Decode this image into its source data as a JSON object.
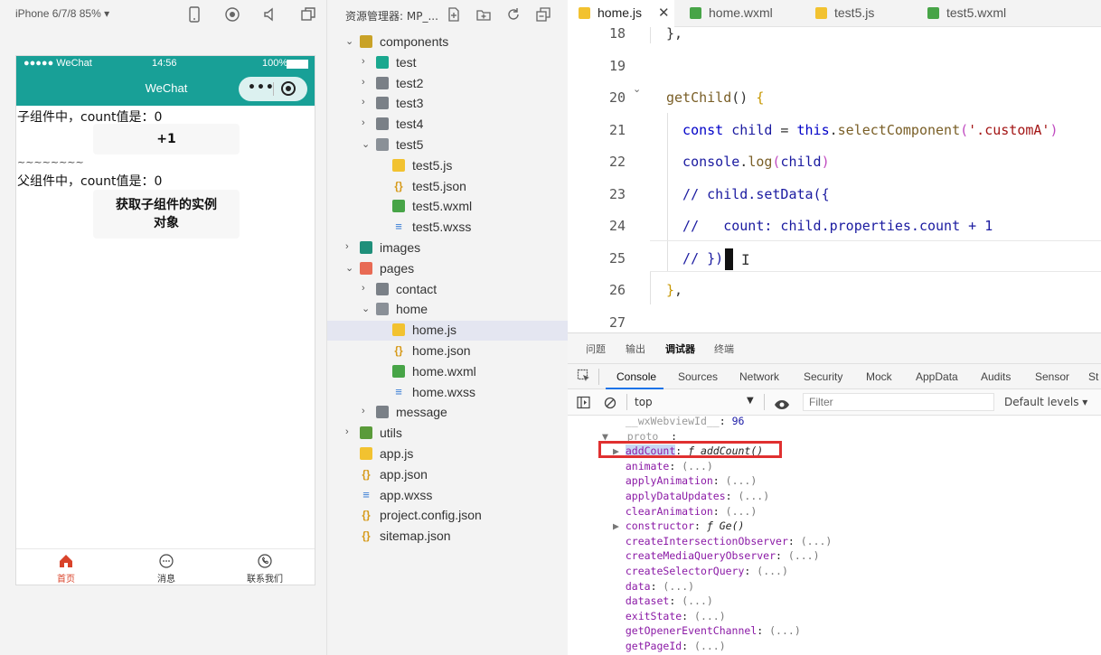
{
  "simulator": {
    "device_label": "iPhone 6/7/8 85% ▾",
    "status_bar": {
      "carrier": "●●●●● WeChat",
      "time": "14:56",
      "battery": "100%"
    },
    "nav_title": "WeChat",
    "capsule_dots": "•••",
    "child_text": "子组件中，count值是：0",
    "plus_button": "+1",
    "divider_text": "~~~~~~~~",
    "parent_text": "父组件中，count值是：0",
    "get_child_button_line1": "获取子组件的实例",
    "get_child_button_line2": "对象",
    "tabbar": [
      {
        "label": "首页",
        "icon": "home-icon",
        "active": true
      },
      {
        "label": "消息",
        "icon": "message-icon",
        "active": false
      },
      {
        "label": "联系我们",
        "icon": "phone-icon",
        "active": false
      }
    ],
    "accent_color": "#18a097"
  },
  "explorer": {
    "title": "资源管理器: MP_...",
    "tree": [
      {
        "label": "components",
        "chev": "⌄",
        "icon": "ic-comp",
        "indent": 0
      },
      {
        "label": "test",
        "chev": "›",
        "icon": "ic-test",
        "indent": 1
      },
      {
        "label": "test2",
        "chev": "›",
        "icon": "ic-folder",
        "indent": 1
      },
      {
        "label": "test3",
        "chev": "›",
        "icon": "ic-folder",
        "indent": 1
      },
      {
        "label": "test4",
        "chev": "›",
        "icon": "ic-folder",
        "indent": 1
      },
      {
        "label": "test5",
        "chev": "⌄",
        "icon": "ic-folder-open",
        "indent": 1
      },
      {
        "label": "test5.js",
        "chev": "",
        "icon": "ic-js",
        "indent": 2
      },
      {
        "label": "test5.json",
        "chev": "",
        "icon": "ic-json",
        "indent": 2
      },
      {
        "label": "test5.wxml",
        "chev": "",
        "icon": "ic-wxml",
        "indent": 2
      },
      {
        "label": "test5.wxss",
        "chev": "",
        "icon": "ic-wxss",
        "indent": 2
      },
      {
        "label": "images",
        "chev": "›",
        "icon": "ic-img",
        "indent": 0
      },
      {
        "label": "pages",
        "chev": "⌄",
        "icon": "ic-pages",
        "indent": 0
      },
      {
        "label": "contact",
        "chev": "›",
        "icon": "ic-folder",
        "indent": 1
      },
      {
        "label": "home",
        "chev": "⌄",
        "icon": "ic-folder-open",
        "indent": 1
      },
      {
        "label": "home.js",
        "chev": "",
        "icon": "ic-js",
        "indent": 2,
        "selected": true
      },
      {
        "label": "home.json",
        "chev": "",
        "icon": "ic-json",
        "indent": 2
      },
      {
        "label": "home.wxml",
        "chev": "",
        "icon": "ic-wxml",
        "indent": 2
      },
      {
        "label": "home.wxss",
        "chev": "",
        "icon": "ic-wxss",
        "indent": 2
      },
      {
        "label": "message",
        "chev": "›",
        "icon": "ic-folder",
        "indent": 1
      },
      {
        "label": "utils",
        "chev": "›",
        "icon": "ic-utils",
        "indent": 0
      },
      {
        "label": "app.js",
        "chev": "",
        "icon": "ic-js",
        "indent": 0
      },
      {
        "label": "app.json",
        "chev": "",
        "icon": "ic-json",
        "indent": 0
      },
      {
        "label": "app.wxss",
        "chev": "",
        "icon": "ic-wxss",
        "indent": 0
      },
      {
        "label": "project.config.json",
        "chev": "",
        "icon": "ic-json",
        "indent": 0
      },
      {
        "label": "sitemap.json",
        "chev": "",
        "icon": "ic-json",
        "indent": 0
      }
    ]
  },
  "editor": {
    "tabs": [
      {
        "label": "home.js",
        "icon": "ic-js",
        "active": true,
        "close": "✕"
      },
      {
        "label": "home.wxml",
        "icon": "ic-wxml",
        "active": false
      },
      {
        "label": "test5.js",
        "icon": "ic-js",
        "active": false
      },
      {
        "label": "test5.wxml",
        "icon": "ic-wxml",
        "active": false
      }
    ],
    "lines": [
      {
        "num": "18",
        "tokens": [
          {
            "t": "},",
            "c": ""
          }
        ]
      },
      {
        "num": "19",
        "tokens": []
      },
      {
        "num": "20",
        "tokens": [
          {
            "t": "getChild",
            "c": "fn"
          },
          {
            "t": "() ",
            "c": ""
          },
          {
            "t": "{",
            "c": "brk"
          }
        ]
      },
      {
        "num": "21",
        "tokens": [
          {
            "t": "  const ",
            "c": "kw"
          },
          {
            "t": "child",
            "c": "cm-blue"
          },
          {
            "t": " = ",
            "c": ""
          },
          {
            "t": "this",
            "c": "kw"
          },
          {
            "t": ".",
            "c": ""
          },
          {
            "t": "selectComponent",
            "c": "fn"
          },
          {
            "t": "(",
            "c": "brk2"
          },
          {
            "t": "'.customA'",
            "c": "str"
          },
          {
            "t": ")",
            "c": "brk2"
          }
        ]
      },
      {
        "num": "22",
        "tokens": [
          {
            "t": "  console",
            "c": "cm-blue"
          },
          {
            "t": ".",
            "c": ""
          },
          {
            "t": "log",
            "c": "fn"
          },
          {
            "t": "(",
            "c": "brk2"
          },
          {
            "t": "child",
            "c": "cm-blue"
          },
          {
            "t": ")",
            "c": "brk2"
          }
        ]
      },
      {
        "num": "23",
        "tokens": [
          {
            "t": "  // child.setData({",
            "c": "cm-blue"
          }
        ]
      },
      {
        "num": "24",
        "tokens": [
          {
            "t": "  //   count: child.properties.count + 1",
            "c": "cm-blue"
          }
        ]
      },
      {
        "num": "25",
        "tokens": [
          {
            "t": "  // })",
            "c": "cm-blue"
          }
        ]
      },
      {
        "num": "26",
        "tokens": [
          {
            "t": "}",
            "c": "brk"
          },
          {
            "t": ",",
            "c": ""
          }
        ]
      },
      {
        "num": "27",
        "tokens": []
      }
    ]
  },
  "devtools": {
    "top_tabs": [
      "问题",
      "输出",
      "调试器",
      "终端"
    ],
    "panels": [
      "Console",
      "Sources",
      "Network",
      "Security",
      "Mock",
      "AppData",
      "Audits",
      "Sensor",
      "St"
    ],
    "context": "top",
    "filter_placeholder": "Filter",
    "levels": "Default levels ▾",
    "console_lines": [
      {
        "arrow": "",
        "key": "__wxWebviewId__",
        "sep": ": ",
        "val": "96",
        "indent": 1,
        "dim": true
      },
      {
        "arrow": "▼",
        "key": "__proto__",
        "sep": ":",
        "val": "",
        "indent": 0,
        "dim": true
      },
      {
        "arrow": "▶",
        "key": "addCount",
        "sep": ": ",
        "val": "ƒ addCount()",
        "indent": 1,
        "selected": true
      },
      {
        "arrow": "",
        "key": "animate",
        "sep": ": ",
        "val": "(...)",
        "indent": 1
      },
      {
        "arrow": "",
        "key": "applyAnimation",
        "sep": ": ",
        "val": "(...)",
        "indent": 1
      },
      {
        "arrow": "",
        "key": "applyDataUpdates",
        "sep": ": ",
        "val": "(...)",
        "indent": 1
      },
      {
        "arrow": "",
        "key": "clearAnimation",
        "sep": ": ",
        "val": "(...)",
        "indent": 1
      },
      {
        "arrow": "▶",
        "key": "constructor",
        "sep": ": ",
        "val": "ƒ Ge()",
        "indent": 1
      },
      {
        "arrow": "",
        "key": "createIntersectionObserver",
        "sep": ": ",
        "val": "(...)",
        "indent": 1
      },
      {
        "arrow": "",
        "key": "createMediaQueryObserver",
        "sep": ": ",
        "val": "(...)",
        "indent": 1
      },
      {
        "arrow": "",
        "key": "createSelectorQuery",
        "sep": ": ",
        "val": "(...)",
        "indent": 1
      },
      {
        "arrow": "",
        "key": "data",
        "sep": ": ",
        "val": "(...)",
        "indent": 1
      },
      {
        "arrow": "",
        "key": "dataset",
        "sep": ": ",
        "val": "(...)",
        "indent": 1
      },
      {
        "arrow": "",
        "key": "exitState",
        "sep": ": ",
        "val": "(...)",
        "indent": 1
      },
      {
        "arrow": "",
        "key": "getOpenerEventChannel",
        "sep": ": ",
        "val": "(...)",
        "indent": 1
      },
      {
        "arrow": "",
        "key": "getPageId",
        "sep": ": ",
        "val": "(...)",
        "indent": 1
      }
    ],
    "highlight_color": "#e03030"
  }
}
